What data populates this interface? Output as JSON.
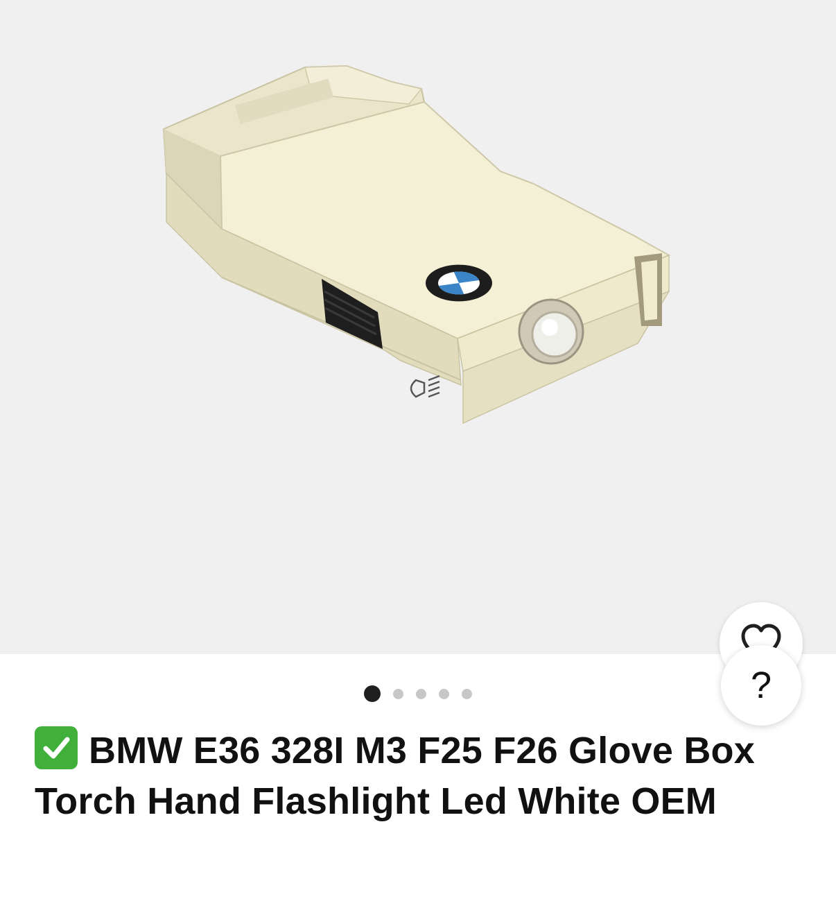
{
  "listing": {
    "title": "BMW E36 328I M3 F25 F26 Glove Box Torch Hand Flashlight Led White OEM",
    "title_prefix_icon": "check-mark-button-icon"
  },
  "gallery": {
    "image_count": 5,
    "active_index": 0
  },
  "actions": {
    "watch_icon": "heart-icon",
    "help_label": "?"
  },
  "colors": {
    "gallery_background": "#f0f0f0",
    "check_badge": "#40b03a",
    "dot_active": "#1f1f1f",
    "dot_inactive": "#c7c7c7"
  }
}
